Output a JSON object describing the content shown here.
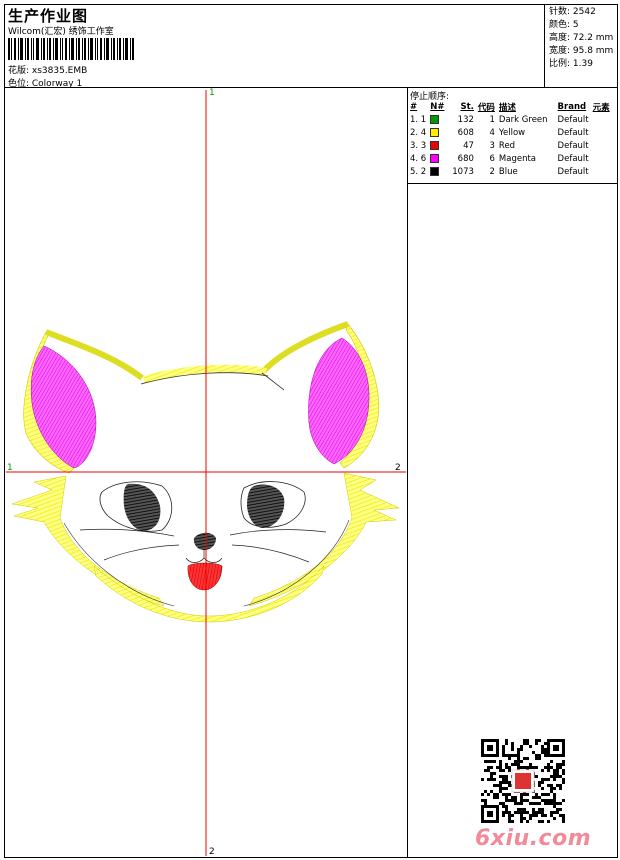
{
  "header": {
    "title": "生产作业图",
    "studio": "Wilcom(汇宏) 绣饰工作室",
    "pattern_label": "花版: xs3835.EMB",
    "colorway_label": "色位: Colorway 1"
  },
  "stats": {
    "stitches": "针数: 2542",
    "colors": "颜色: 5",
    "height": "高度: 72.2 mm",
    "width": "宽度: 95.8 mm",
    "scale": "比例: 1.39"
  },
  "stop_sequence": {
    "title": "停止顺序:",
    "columns": [
      "#",
      "N#",
      "St.",
      "代码",
      "描述",
      "Brand",
      "元素"
    ],
    "rows": [
      {
        "num": "1. 1",
        "color": "#009900",
        "st": "132",
        "code": "1",
        "desc": "Dark Green",
        "brand": "Default"
      },
      {
        "num": "2. 4",
        "color": "#ffee00",
        "st": "608",
        "code": "4",
        "desc": "Yellow",
        "brand": "Default"
      },
      {
        "num": "3. 3",
        "color": "#ee0000",
        "st": "47",
        "code": "3",
        "desc": "Red",
        "brand": "Default"
      },
      {
        "num": "4. 6",
        "color": "#ff00ff",
        "st": "680",
        "code": "6",
        "desc": "Magenta",
        "brand": "Default"
      },
      {
        "num": "5. 2",
        "color": "#000000",
        "st": "1073",
        "code": "2",
        "desc": "Blue",
        "brand": "Default"
      }
    ]
  },
  "axis_labels": {
    "top": "1",
    "bottom": "2",
    "left": "1",
    "right": "2"
  },
  "watermark": "6xiu.com",
  "colors": {
    "axis": "#ee0000",
    "outline": "#ffff44",
    "ear": "#ff22ff",
    "eye": "#000000",
    "tongue": "#ff2222"
  }
}
